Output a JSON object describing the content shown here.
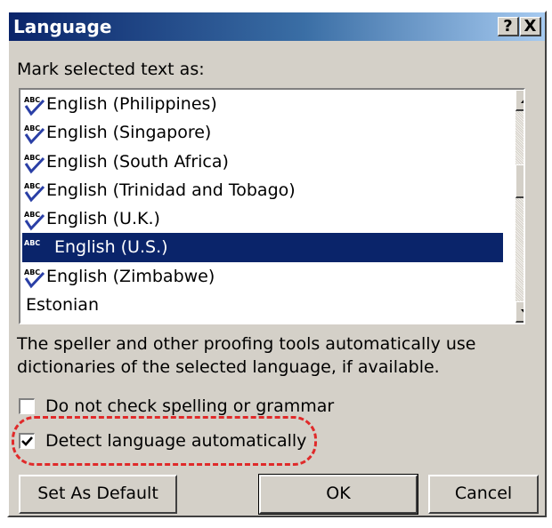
{
  "window": {
    "title": "Language",
    "help_label": "?",
    "close_label": "X"
  },
  "list_label": "Mark selected text as:",
  "languages": [
    {
      "label": "English (Philippines)",
      "spell_icon": true,
      "selected": false
    },
    {
      "label": "English (Singapore)",
      "spell_icon": true,
      "selected": false
    },
    {
      "label": "English (South Africa)",
      "spell_icon": true,
      "selected": false
    },
    {
      "label": "English (Trinidad and Tobago)",
      "spell_icon": true,
      "selected": false
    },
    {
      "label": "English (U.K.)",
      "spell_icon": true,
      "selected": false
    },
    {
      "label": "English (U.S.)",
      "spell_icon": true,
      "selected": true
    },
    {
      "label": "English (Zimbabwe)",
      "spell_icon": true,
      "selected": false
    },
    {
      "label": "Estonian",
      "spell_icon": false,
      "selected": false
    }
  ],
  "info_text": "The speller and other proofing tools automatically use dictionaries of the selected language, if available.",
  "options": {
    "no_check": {
      "label": "Do not check spelling or grammar",
      "checked": false
    },
    "detect": {
      "label": "Detect language automatically",
      "checked": true
    }
  },
  "buttons": {
    "set_default": "Set As Default",
    "ok": "OK",
    "cancel": "Cancel"
  },
  "colors": {
    "selection": "#0a246a",
    "highlight": "#e02a2a",
    "face": "#d4d0c8"
  }
}
